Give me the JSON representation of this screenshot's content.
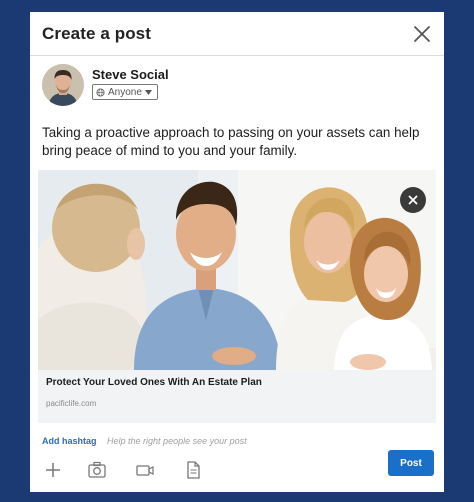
{
  "dialog": {
    "title": "Create a post"
  },
  "author": {
    "name": "Steve Social",
    "visibility": "Anyone"
  },
  "post": {
    "text": "Taking a proactive approach to passing on your assets can help bring peace of mind to you and your family."
  },
  "preview": {
    "title": "Protect Your Loved Ones With An Estate Plan",
    "domain": "pacificlife.com"
  },
  "hashtag": {
    "add_label": "Add hashtag",
    "hint": "Help the right people see your post"
  },
  "toolbar": {
    "icons": [
      "plus-icon",
      "camera-icon",
      "video-icon",
      "document-icon"
    ]
  },
  "actions": {
    "post_label": "Post"
  },
  "colors": {
    "page_background": "#1b3a73",
    "accent": "#1a6fc9",
    "link": "#2b6db6"
  }
}
